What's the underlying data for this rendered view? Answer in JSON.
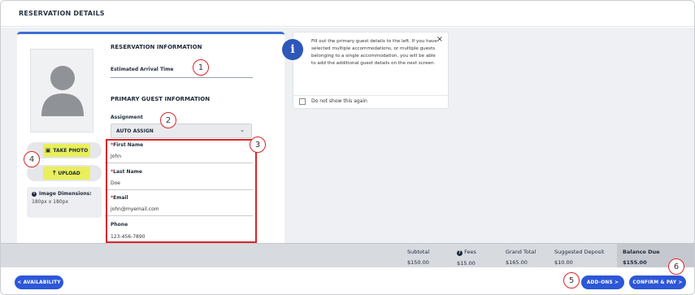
{
  "header": {
    "title": "RESERVATION DETAILS"
  },
  "card": {
    "reservation_info_title": "RESERVATION INFORMATION",
    "arrival_label": "Estimated Arrival Time",
    "primary_guest_title": "PRIMARY GUEST INFORMATION",
    "assignment_label": "Assignment",
    "assignment_value": "AUTO ASSIGN",
    "take_photo_label": "TAKE PHOTO",
    "upload_label": "UPLOAD",
    "image_dims_title": "Image Dimensions:",
    "image_dims_value": "180px x 180px",
    "fields": [
      {
        "required": "*",
        "label": "First Name",
        "value": "John"
      },
      {
        "required": "*",
        "label": "Last Name",
        "value": "Doe"
      },
      {
        "required": "*",
        "label": "Email",
        "value": "john@myemail.com"
      },
      {
        "required": "",
        "label": "Phone",
        "value": "123-456-7890"
      }
    ]
  },
  "info": {
    "icon": "info-icon",
    "message": "Fill out the primary guest details to the left. If you have selected multiple accommodations, or multiple guests belonging to a single accommodation, you will be able to add the additional guest details on the next screen.",
    "checkbox_label": "Do not show this again",
    "close_glyph": "×"
  },
  "totals": [
    {
      "label": "Subtotal",
      "value": "$150.00"
    },
    {
      "label": "Fees",
      "value": "$15.00"
    },
    {
      "label": "Grand Total",
      "value": "$165.00"
    },
    {
      "label": "Suggested Deposit",
      "value": "$10.00"
    },
    {
      "label": "Balance Due",
      "value": "$155.00"
    }
  ],
  "footer": {
    "availability_label": "< AVAILABILITY",
    "addons_label": "ADD-ONS >",
    "confirm_label": "CONFIRM & PAY >"
  },
  "annotations": [
    "1",
    "2",
    "3",
    "4",
    "5",
    "6"
  ],
  "colors": {
    "accent": "#2d57d8",
    "annotation": "#d8262b",
    "photo_button": "#e9ef5a"
  }
}
